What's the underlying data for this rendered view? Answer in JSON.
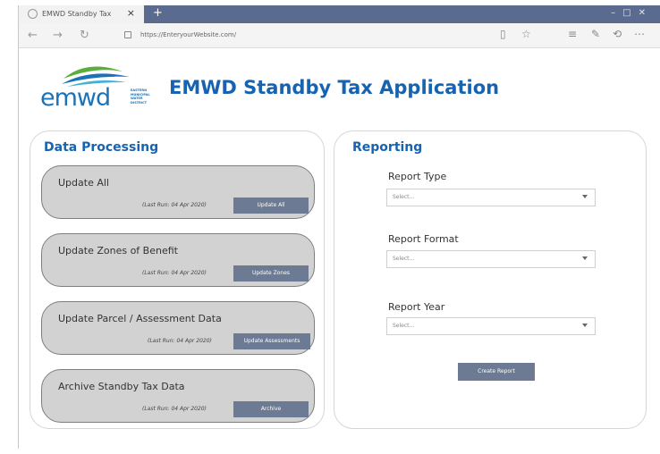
{
  "browser": {
    "tab_title": "EMWD Standby Tax",
    "tab_close": "×",
    "new_tab": "+",
    "url": "https://EnteryourWebsite.com/"
  },
  "logo": {
    "word": "emwd",
    "subtitle": "EASTERN MUNICIPAL WATER DISTRICT"
  },
  "app_title": "EMWD Standby Tax Application",
  "data_processing": {
    "title": "Data Processing",
    "items": [
      {
        "title": "Update All",
        "last_run": "(Last Run: 04 Apr 2020)",
        "button": "Update All"
      },
      {
        "title": "Update Zones of Benefit",
        "last_run": "(Last Run: 04 Apr 2020)",
        "button": "Update Zones"
      },
      {
        "title": "Update Parcel / Assessment Data",
        "last_run": "(Last Run: 04 Apr 2020)",
        "button": "Update Assessments"
      },
      {
        "title": "Archive Standby Tax Data",
        "last_run": "(Last Run: 04 Apr 2020)",
        "button": "Archive"
      }
    ]
  },
  "reporting": {
    "title": "Reporting",
    "fields": [
      {
        "label": "Report Type",
        "placeholder": "Select..."
      },
      {
        "label": "Report Format",
        "placeholder": "Select..."
      },
      {
        "label": "Report Year",
        "placeholder": "Select..."
      }
    ],
    "create_button": "Create Report"
  },
  "colors": {
    "accent": "#1763b0",
    "tabbar": "#5b6a8f",
    "button": "#6c7a93",
    "card": "#d2d2d2"
  }
}
